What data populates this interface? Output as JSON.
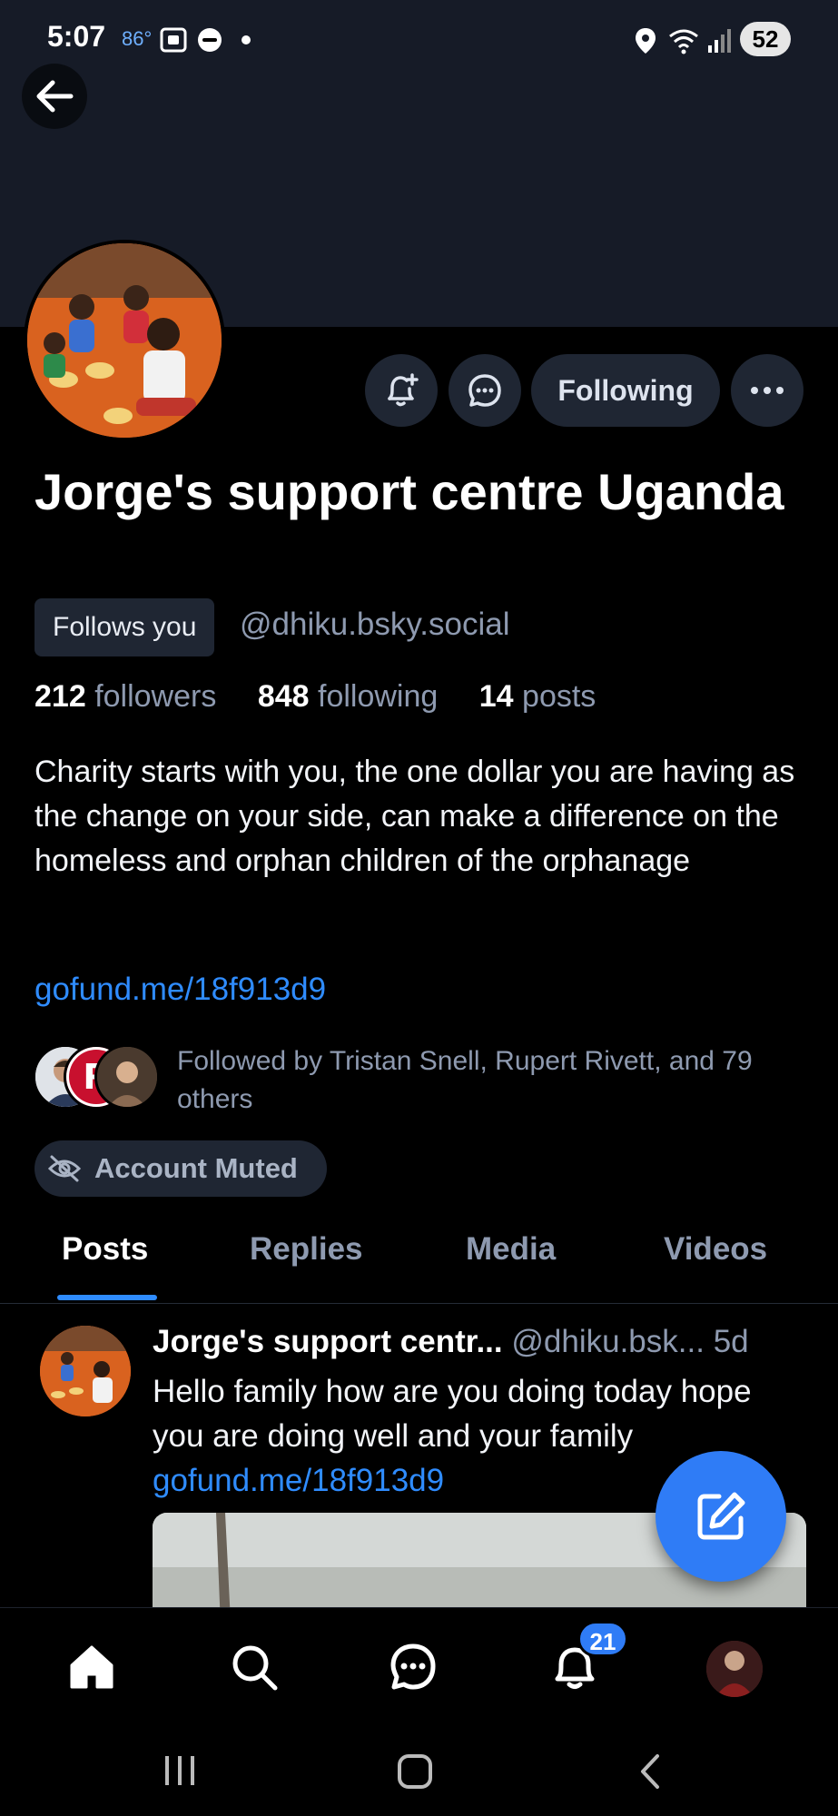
{
  "status_bar": {
    "time": "5:07",
    "temperature": "86°",
    "battery": "52",
    "icons": [
      "screenshot-icon",
      "wear-icon",
      "dot-icon",
      "location-icon",
      "wifi-icon",
      "signal-icon"
    ]
  },
  "profile": {
    "display_name": "Jorge's support centre Uganda",
    "follows_you_label": "Follows you",
    "handle": "@dhiku.bsky.social",
    "stats": {
      "followers_count": "212",
      "followers_label": "followers",
      "following_count": "848",
      "following_label": "following",
      "posts_count": "14",
      "posts_label": "posts"
    },
    "bio": "Charity starts with you, the one dollar you are having as the change on your side, can make a difference on the homeless and orphan children of the orphanage",
    "link": "gofund.me/18f913d9",
    "followed_by": "Followed by Tristan Snell, Rupert Rivett, and 79 others",
    "muted_label": "Account Muted"
  },
  "actions": {
    "following_label": "Following"
  },
  "tabs": [
    {
      "label": "Posts",
      "active": true
    },
    {
      "label": "Replies",
      "active": false
    },
    {
      "label": "Media",
      "active": false
    },
    {
      "label": "Videos",
      "active": false
    }
  ],
  "post": {
    "author_name": "Jorge's support centr...",
    "author_handle": "@dhiku.bsk...",
    "age": "5d",
    "text": "Hello family how are you doing today hope you are doing well and your family",
    "link": "gofund.me/18f913d9"
  },
  "bottom_nav": {
    "notifications_badge": "21",
    "items": [
      "home-icon",
      "search-icon",
      "chat-icon",
      "bell-icon",
      "profile-avatar"
    ]
  },
  "colors": {
    "accent": "#2f8cff",
    "background": "#000000",
    "banner": "#161b27",
    "chip": "#1f2633",
    "muted_text": "#8e9ab0"
  }
}
